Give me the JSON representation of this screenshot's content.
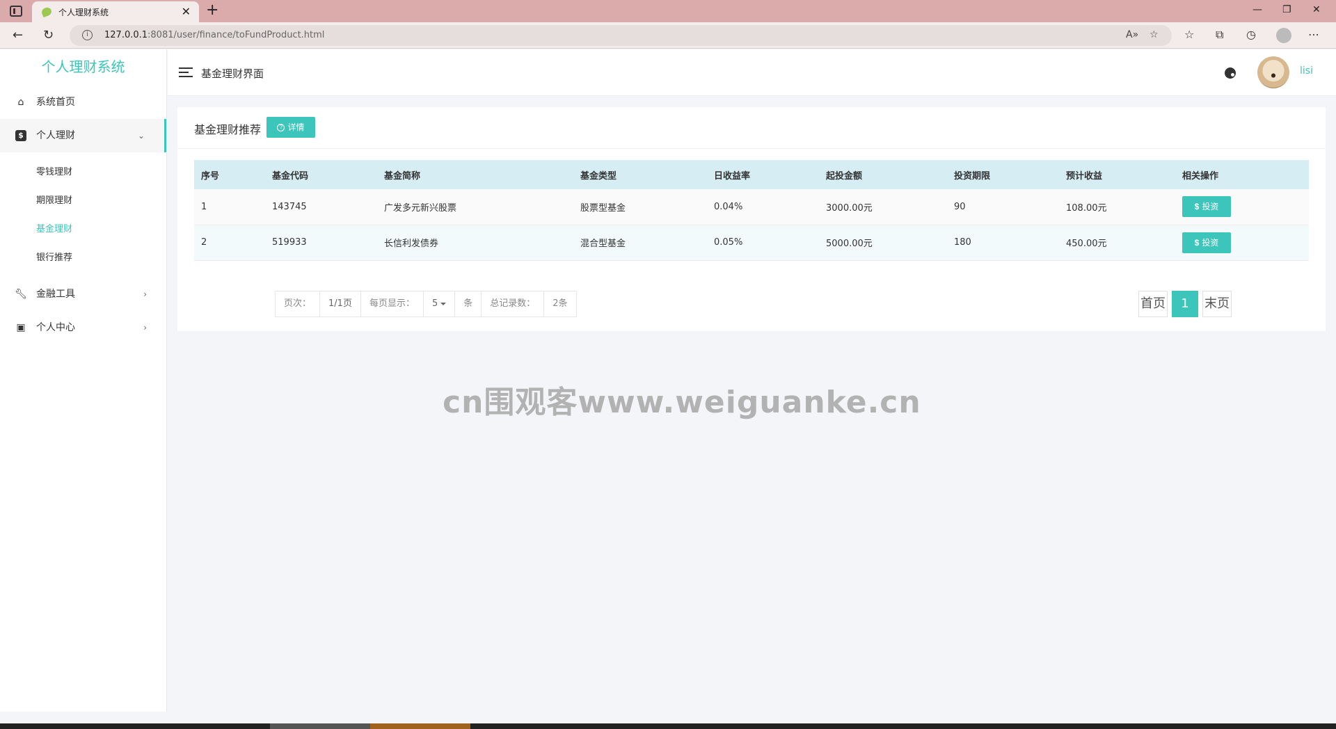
{
  "browser": {
    "tab_title": "个人理财系统",
    "url_host": "127.0.0.1",
    "url_rest": ":8081/user/finance/toFundProduct.html"
  },
  "sidebar": {
    "logo": "个人理财系统",
    "items": [
      {
        "label": "系统首页",
        "icon": "home-icon"
      },
      {
        "label": "个人理财",
        "icon": "dollar-icon",
        "expanded": true,
        "children": [
          {
            "label": "零钱理财"
          },
          {
            "label": "期限理财"
          },
          {
            "label": "基金理财",
            "active": true
          },
          {
            "label": "银行推荐"
          }
        ]
      },
      {
        "label": "金融工具",
        "icon": "wrench-icon"
      },
      {
        "label": "个人中心",
        "icon": "contact-card-icon"
      }
    ]
  },
  "header": {
    "title": "基金理财界面",
    "username": "lisi"
  },
  "card": {
    "title": "基金理财推荐",
    "detail_label": "详情"
  },
  "table": {
    "columns": [
      "序号",
      "基金代码",
      "基金简称",
      "基金类型",
      "日收益率",
      "起投金额",
      "投资期限",
      "预计收益",
      "相关操作"
    ],
    "action_label": "投资",
    "rows": [
      [
        "1",
        "143745",
        "广发多元新兴股票",
        "股票型基金",
        "0.04%",
        "3000.00元",
        "90",
        "108.00元"
      ],
      [
        "2",
        "519933",
        "长信利发债券",
        "混合型基金",
        "0.05%",
        "5000.00元",
        "180",
        "450.00元"
      ]
    ]
  },
  "pager": {
    "page_label": "页次：",
    "page_value": "1/1页",
    "per_page_label": "每页显示：",
    "per_page_value": "5",
    "per_page_unit": "条",
    "total_label": "总记录数：",
    "total_value": "2条",
    "first": "首页",
    "current": "1",
    "last": "末页"
  },
  "watermark": "cn围观客www.weiguanke.cn",
  "colors": {
    "accent": "#3cc5ba",
    "table_header": "#d6edf4"
  }
}
